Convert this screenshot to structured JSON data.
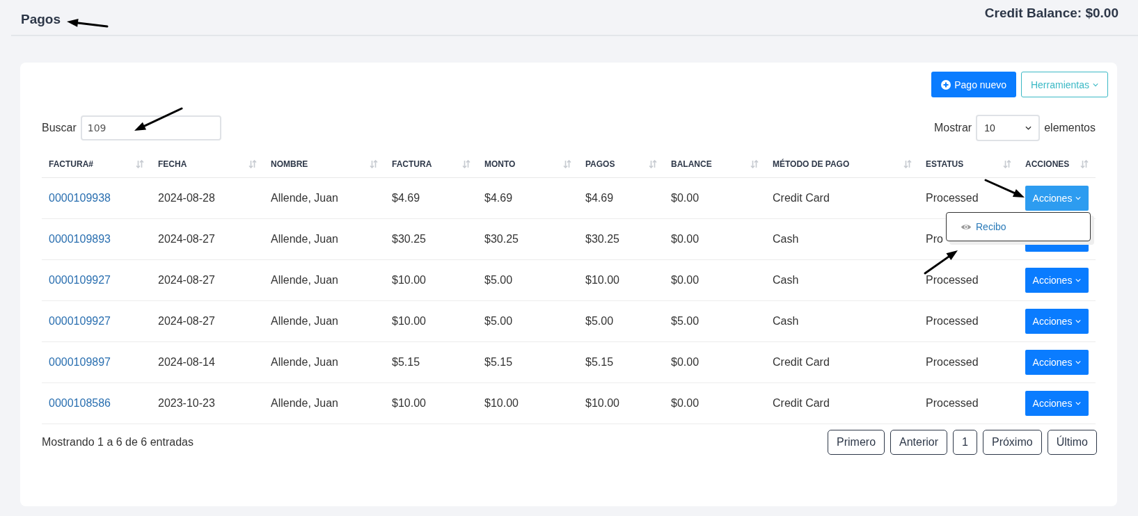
{
  "header": {
    "title": "Pagos",
    "credit_balance": "Credit Balance: $0.00"
  },
  "toolbar": {
    "new_button": "Pago nuevo",
    "tools_button": "Herramientas"
  },
  "search": {
    "label": "Buscar",
    "value": "109"
  },
  "page_size": {
    "label": "Mostrar",
    "value": "10",
    "suffix": "elementos"
  },
  "table": {
    "columns": [
      "FACTURA#",
      "FECHA",
      "NOMBRE",
      "FACTURA",
      "MONTO",
      "PAGOS",
      "BALANCE",
      "MÉTODO DE PAGO",
      "ESTATUS",
      "ACCIONES"
    ],
    "rows": [
      {
        "cells": [
          "0000109938",
          "2024-08-28",
          "Allende, Juan",
          "$4.69",
          "$4.69",
          "$4.69",
          "$0.00",
          "Credit Card",
          "Processed"
        ],
        "action": {
          "label": "Acciones",
          "expanded": true,
          "menu": [
            {
              "label": "Recibo"
            }
          ]
        }
      },
      {
        "cells": [
          "0000109893",
          "2024-08-27",
          "Allende, Juan",
          "$30.25",
          "$30.25",
          "$30.25",
          "$0.00",
          "Cash",
          "Pro"
        ],
        "action": {
          "expanded": false
        }
      },
      {
        "cells": [
          "0000109927",
          "2024-08-27",
          "Allende, Juan",
          "$10.00",
          "$5.00",
          "$10.00",
          "$0.00",
          "Cash",
          "Processed"
        ],
        "action": {
          "label": "Acciones",
          "expanded": false
        }
      },
      {
        "cells": [
          "0000109927",
          "2024-08-27",
          "Allende, Juan",
          "$10.00",
          "$5.00",
          "$5.00",
          "$5.00",
          "Cash",
          "Processed"
        ],
        "action": {
          "label": "Acciones",
          "expanded": false
        }
      },
      {
        "cells": [
          "0000109897",
          "2024-08-14",
          "Allende, Juan",
          "$5.15",
          "$5.15",
          "$5.15",
          "$0.00",
          "Credit Card",
          "Processed"
        ],
        "action": {
          "label": "Acciones",
          "expanded": false
        }
      },
      {
        "cells": [
          "0000108586",
          "2023-10-23",
          "Allende, Juan",
          "$10.00",
          "$10.00",
          "$10.00",
          "$0.00",
          "Credit Card",
          "Processed"
        ],
        "action": {
          "label": "Acciones",
          "expanded": false
        }
      }
    ]
  },
  "summary": "Mostrando 1 a 6 de 6 entradas",
  "pagination": [
    "Primero",
    "Anterior",
    "1",
    "Próximo",
    "Último"
  ]
}
